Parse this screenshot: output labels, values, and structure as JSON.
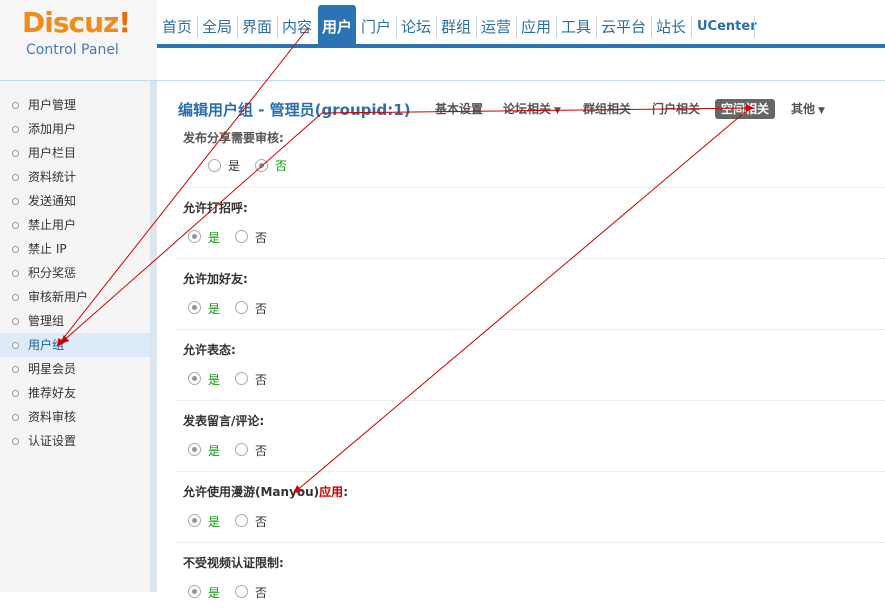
{
  "logo": {
    "word": "Discuz",
    "bang": "!",
    "subtitle": "Control Panel"
  },
  "nav": {
    "items": [
      "首页",
      "全局",
      "界面",
      "内容",
      "用户",
      "门户",
      "论坛",
      "群组",
      "运营",
      "应用",
      "工具",
      "云平台",
      "站长",
      "UCenter"
    ],
    "active": "用户"
  },
  "sidebar": {
    "items": [
      "用户管理",
      "添加用户",
      "用户栏目",
      "资料统计",
      "发送通知",
      "禁止用户",
      "禁止 IP",
      "积分奖惩",
      "审核新用户",
      "管理组",
      "用户组",
      "明星会员",
      "推荐好友",
      "资料审核",
      "认证设置"
    ],
    "active_index": 10
  },
  "main": {
    "title": "编辑用户组 - 管理员(groupid:1)",
    "tabs": [
      {
        "label": "基本设置"
      },
      {
        "label": "论坛相关",
        "dropdown": true
      },
      {
        "label": "群组相关"
      },
      {
        "label": "门户相关"
      },
      {
        "label": "空间相关",
        "active": true
      },
      {
        "label": "其他",
        "dropdown": true
      }
    ],
    "partial_row_label": "发布分享需要审核:",
    "rows": [
      {
        "label": "允许打招呼:",
        "value": "是"
      },
      {
        "label": "允许加好友:",
        "value": "是"
      },
      {
        "label": "允许表态:",
        "value": "是"
      },
      {
        "label": "发表留言/评论:",
        "value": "是"
      },
      {
        "label_prefix": "允许使用漫游(Manyou)",
        "label_highlight": "应用",
        "label_suffix": ":",
        "value": "是"
      },
      {
        "label": "不受视频认证限制:",
        "value": "是"
      }
    ],
    "first_row_value": "否",
    "yes": "是",
    "no": "否"
  },
  "annotation_color": "#cc0000"
}
